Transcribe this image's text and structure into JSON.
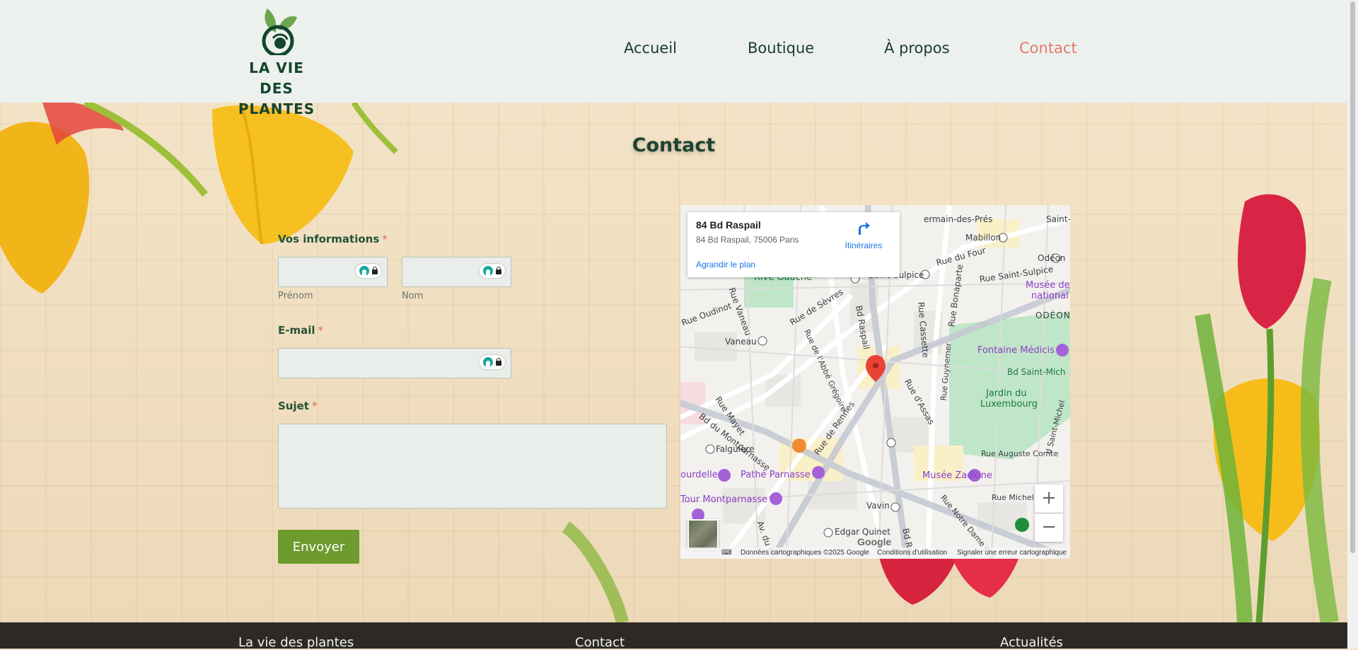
{
  "brand": {
    "name_line1": "LA VIE DES",
    "name_line2": "PLANTES"
  },
  "nav": {
    "items": [
      {
        "label": "Accueil"
      },
      {
        "label": "Boutique"
      },
      {
        "label": "À propos"
      },
      {
        "label": "Contact"
      }
    ],
    "active_color": "#e8776a"
  },
  "page": {
    "title": "Contact"
  },
  "form": {
    "info_label": "Vos informations",
    "required_mark": "*",
    "first_name_sublabel": "Prénom",
    "last_name_sublabel": "Nom",
    "email_label": "E-mail",
    "subject_label": "Sujet",
    "submit_label": "Envoyer",
    "first_name_value": "",
    "last_name_value": "",
    "email_value": "",
    "subject_value": ""
  },
  "map": {
    "place_title": "84 Bd Raspail",
    "place_address": "84 Bd Raspail, 75006 Paris",
    "directions_label": "Itinéraires",
    "enlarge_label": "Agrandir le plan",
    "labels": {
      "st_germain_des_pres": "ermain-des-Prés",
      "mabillon": "Mabillon",
      "saint_l": "Saint-L",
      "rue_du_four": "Rue du Four",
      "odeon": "Odéon",
      "rive_gauche": "Rive Gauche",
      "saint_sulpice": "Saint-Sulpice",
      "rue_saint_sulpice": "Rue Saint-Sulpice",
      "musee_national": "Musée de",
      "musee_national2": "national d",
      "odeon_caps": "ODÉON",
      "rue_oudinot": "Rue Oudinot",
      "rue_vaneau": "Rue Vaneau",
      "rue_de_sevres": "Rue de Sèvres",
      "bd_raspail_top": "Bd Raspail",
      "rue_cassette": "Rue Cassette",
      "rue_bonaparte": "Rue Bonaparte",
      "vaneau": "Vaneau",
      "rue_abbe_gregoire": "Rue de l'Abbé Grégoire",
      "fontaine_medicis": "Fontaine Médicis",
      "bd_saint_mich": "Bd Saint-Mich",
      "rue_assas": "Rue d'Assas",
      "rue_guynemer": "Rue Guynemer",
      "jardin": "Jardin du",
      "luxembourg": "Luxembourg",
      "rue_mayet": "Rue Mayet",
      "bd_montparnasse": "Bd du Montparnasse",
      "falguiere": "Falguière",
      "rue_de_rennes": "Rue de Rennes",
      "rue_auguste_comte": "Rue Auguste Comte",
      "bourdelle": "ourdelle",
      "pathe": "Pathé Parnasse",
      "musee_zadkine": "Musée Zadkine",
      "tour_montparnasse": "Tour Montparnasse",
      "vavin": "Vavin",
      "rue_michel": "Rue Michel",
      "edgar_quinet": "Edgar Quinet",
      "av_du_maine": "Av. du M",
      "bd_raspail_bottom": "Bd Ras",
      "rue_notre_dame": "Rue Notre Dame des Ch",
      "bd_saint_michel_v": "d Saint-Michel",
      "metro_m": "M"
    },
    "attribution": {
      "data": "Données cartographiques ©2025 Google",
      "terms": "Conditions d'utilisation",
      "report": "Signaler une erreur cartographique",
      "google": "Google"
    },
    "zoom_in": "+",
    "zoom_out": "−",
    "icons": [
      "directions-icon",
      "red-pin-icon",
      "keyboard-icon",
      "metro-icon",
      "museum-icon",
      "restaurant-icon",
      "park-icon"
    ]
  },
  "footer": {
    "col1": "La vie des plantes",
    "col2": "Contact",
    "col3": "Actualités"
  }
}
